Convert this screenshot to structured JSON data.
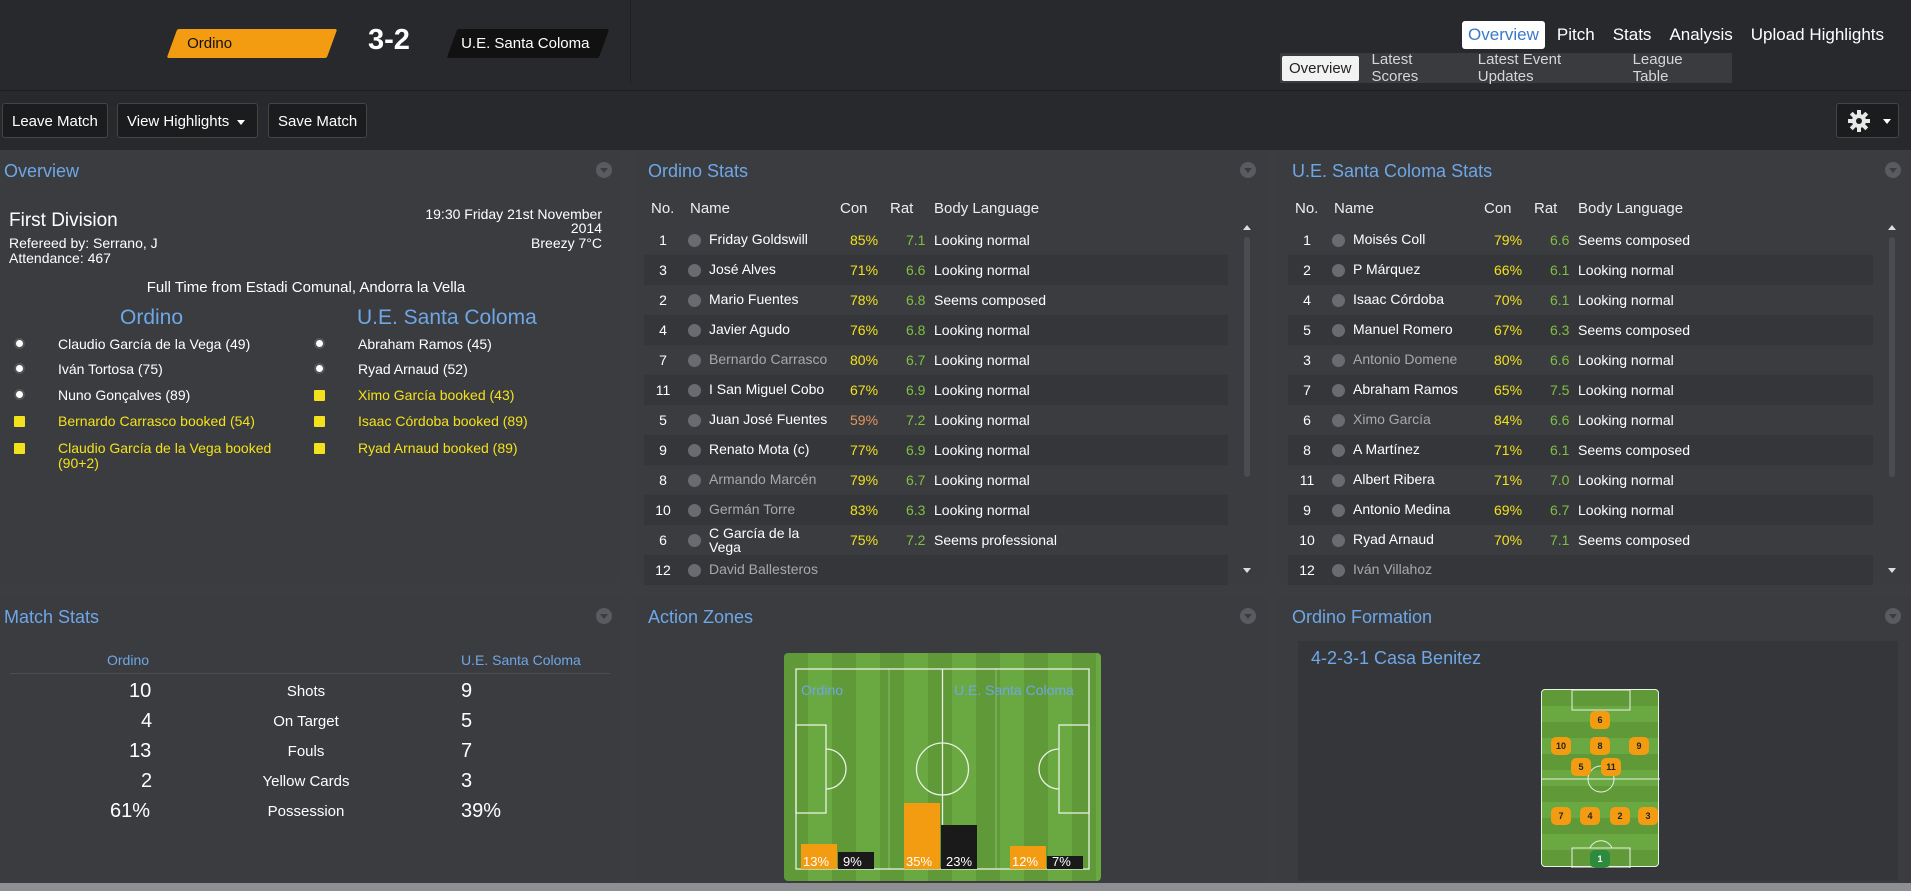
{
  "header": {
    "team_home": "Ordino",
    "score": "3-2",
    "team_away": "U.E. Santa Coloma",
    "main_nav": [
      "Overview",
      "Pitch",
      "Stats",
      "Analysis",
      "Upload Highlights"
    ],
    "main_nav_selected": "Overview",
    "sub_nav": [
      "Overview",
      "Latest Scores",
      "Latest Event Updates",
      "League Table"
    ],
    "sub_nav_selected": "Overview"
  },
  "toolbar": {
    "leave_label": "Leave Match",
    "highlights_label": "View Highlights",
    "save_label": "Save Match"
  },
  "overview": {
    "title": "Overview",
    "competition": "First Division",
    "datetime_line1": "19:30 Friday 21st November",
    "datetime_line2": "2014",
    "referee": "Refereed by: Serrano, J",
    "weather": "Breezy 7°C",
    "attendance": "Attendance: 467",
    "status": "Full Time from Estadi Comunal, Andorra la Vella",
    "home_team": "Ordino",
    "away_team": "U.E. Santa Coloma",
    "home_events": [
      {
        "type": "goal",
        "text": "Claudio García de la Vega (49)"
      },
      {
        "type": "goal",
        "text": "Iván Tortosa (75)"
      },
      {
        "type": "goal",
        "text": "Nuno Gonçalves (89)"
      },
      {
        "type": "card",
        "text": "Bernardo Carrasco booked (54)"
      },
      {
        "type": "card",
        "text": "Claudio García de la Vega booked",
        "text2": "(90+2)"
      }
    ],
    "away_events": [
      {
        "type": "goal",
        "text": "Abraham Ramos (45)"
      },
      {
        "type": "goal",
        "text": "Ryad Arnaud (52)"
      },
      {
        "type": "card",
        "text": "Ximo García booked (43)"
      },
      {
        "type": "card",
        "text": "Isaac Córdoba booked (89)"
      },
      {
        "type": "card",
        "text": "Ryad Arnaud booked (89)"
      }
    ]
  },
  "stats_headers": [
    "No.",
    "Name",
    "Con",
    "Rat",
    "Body Language"
  ],
  "home_stats": {
    "title": "Ordino Stats",
    "players": [
      {
        "no": "1",
        "name": "Friday Goldswill",
        "con": "85%",
        "rat": "7.1",
        "body": "Looking normal",
        "sub": false
      },
      {
        "no": "3",
        "name": "José Alves",
        "con": "71%",
        "rat": "6.6",
        "body": "Looking normal",
        "sub": false
      },
      {
        "no": "2",
        "name": "Mario Fuentes",
        "con": "78%",
        "rat": "6.8",
        "body": "Seems composed",
        "sub": false
      },
      {
        "no": "4",
        "name": "Javier Agudo",
        "con": "76%",
        "rat": "6.8",
        "body": "Looking normal",
        "sub": false
      },
      {
        "no": "7",
        "name": "Bernardo Carrasco",
        "con": "80%",
        "rat": "6.7",
        "body": "Looking normal",
        "sub": true
      },
      {
        "no": "11",
        "name": "I San Miguel Cobo",
        "con": "67%",
        "rat": "6.9",
        "body": "Looking normal",
        "sub": false
      },
      {
        "no": "5",
        "name": "Juan José Fuentes",
        "con": "59%",
        "rat": "7.2",
        "body": "Looking normal",
        "sub": false,
        "con_color": "#e8955a"
      },
      {
        "no": "9",
        "name": "Renato Mota (c)",
        "con": "77%",
        "rat": "6.9",
        "body": "Looking normal",
        "sub": false
      },
      {
        "no": "8",
        "name": "Armando Marcén",
        "con": "79%",
        "rat": "6.7",
        "body": "Looking normal",
        "sub": true
      },
      {
        "no": "10",
        "name": "Germán Torre",
        "con": "83%",
        "rat": "6.3",
        "body": "Looking normal",
        "sub": true
      },
      {
        "no": "6",
        "name": "C García de la",
        "name2": "Vega",
        "con": "75%",
        "rat": "7.2",
        "body": "Seems professional",
        "sub": false
      },
      {
        "no": "12",
        "name": "David Ballesteros",
        "con": "",
        "rat": "",
        "body": "",
        "sub": true
      }
    ]
  },
  "away_stats": {
    "title": "U.E. Santa Coloma Stats",
    "players": [
      {
        "no": "1",
        "name": "Moisés Coll",
        "con": "79%",
        "rat": "6.6",
        "body": "Seems composed",
        "sub": false
      },
      {
        "no": "2",
        "name": "P Márquez",
        "con": "66%",
        "rat": "6.1",
        "body": "Looking normal",
        "sub": false
      },
      {
        "no": "4",
        "name": "Isaac Córdoba",
        "con": "70%",
        "rat": "6.1",
        "body": "Looking normal",
        "sub": false
      },
      {
        "no": "5",
        "name": "Manuel Romero",
        "con": "67%",
        "rat": "6.3",
        "body": "Seems composed",
        "sub": false
      },
      {
        "no": "3",
        "name": "Antonio Domene",
        "con": "80%",
        "rat": "6.6",
        "body": "Looking normal",
        "sub": true
      },
      {
        "no": "7",
        "name": "Abraham Ramos",
        "con": "65%",
        "rat": "7.5",
        "body": "Looking normal",
        "sub": false
      },
      {
        "no": "6",
        "name": "Ximo García",
        "con": "84%",
        "rat": "6.6",
        "body": "Looking normal",
        "sub": true
      },
      {
        "no": "8",
        "name": "A Martínez",
        "con": "71%",
        "rat": "6.1",
        "body": "Seems composed",
        "sub": false
      },
      {
        "no": "11",
        "name": "Albert Ribera",
        "con": "71%",
        "rat": "7.0",
        "body": "Looking normal",
        "sub": false
      },
      {
        "no": "9",
        "name": "Antonio Medina",
        "con": "69%",
        "rat": "6.7",
        "body": "Looking normal",
        "sub": false
      },
      {
        "no": "10",
        "name": "Ryad Arnaud",
        "con": "70%",
        "rat": "7.1",
        "body": "Seems composed",
        "sub": false
      },
      {
        "no": "12",
        "name": "Iván Villahoz",
        "con": "",
        "rat": "",
        "body": "",
        "sub": true
      }
    ]
  },
  "match_stats": {
    "title": "Match Stats",
    "home": "Ordino",
    "away": "U.E. Santa Coloma",
    "rows": [
      {
        "label": "Shots",
        "home": "10",
        "away": "9"
      },
      {
        "label": "On Target",
        "home": "4",
        "away": "5"
      },
      {
        "label": "Fouls",
        "home": "13",
        "away": "7"
      },
      {
        "label": "Yellow Cards",
        "home": "2",
        "away": "3"
      },
      {
        "label": "Possession",
        "home": "61%",
        "away": "39%"
      }
    ]
  },
  "action_zones": {
    "title": "Action Zones",
    "home": "Ordino",
    "away": "U.E. Santa Coloma",
    "zones": [
      {
        "home_pct": 13,
        "away_pct": 9,
        "home_label": "13%",
        "away_label": "9%"
      },
      {
        "home_pct": 35,
        "away_pct": 23,
        "home_label": "35%",
        "away_label": "23%"
      },
      {
        "home_pct": 12,
        "away_pct": 7,
        "home_label": "12%",
        "away_label": "7%"
      }
    ]
  },
  "formation": {
    "title": "Ordino Formation",
    "name": "4-2-3-1 Casa Benitez",
    "players": [
      {
        "num": "6"
      },
      {
        "num": "10"
      },
      {
        "num": "8"
      },
      {
        "num": "9"
      },
      {
        "num": "5"
      },
      {
        "num": "11"
      },
      {
        "num": "7"
      },
      {
        "num": "4"
      },
      {
        "num": "2"
      },
      {
        "num": "3"
      },
      {
        "num": "1",
        "gk": true
      }
    ]
  },
  "colors": {
    "accent_blue": "#6ea7e6",
    "home_orange": "#f39c12",
    "away_black": "#111111",
    "con_yellow": "#f3e21b",
    "rat_green": "#7ec141",
    "pitch_green": "#5f9938"
  }
}
